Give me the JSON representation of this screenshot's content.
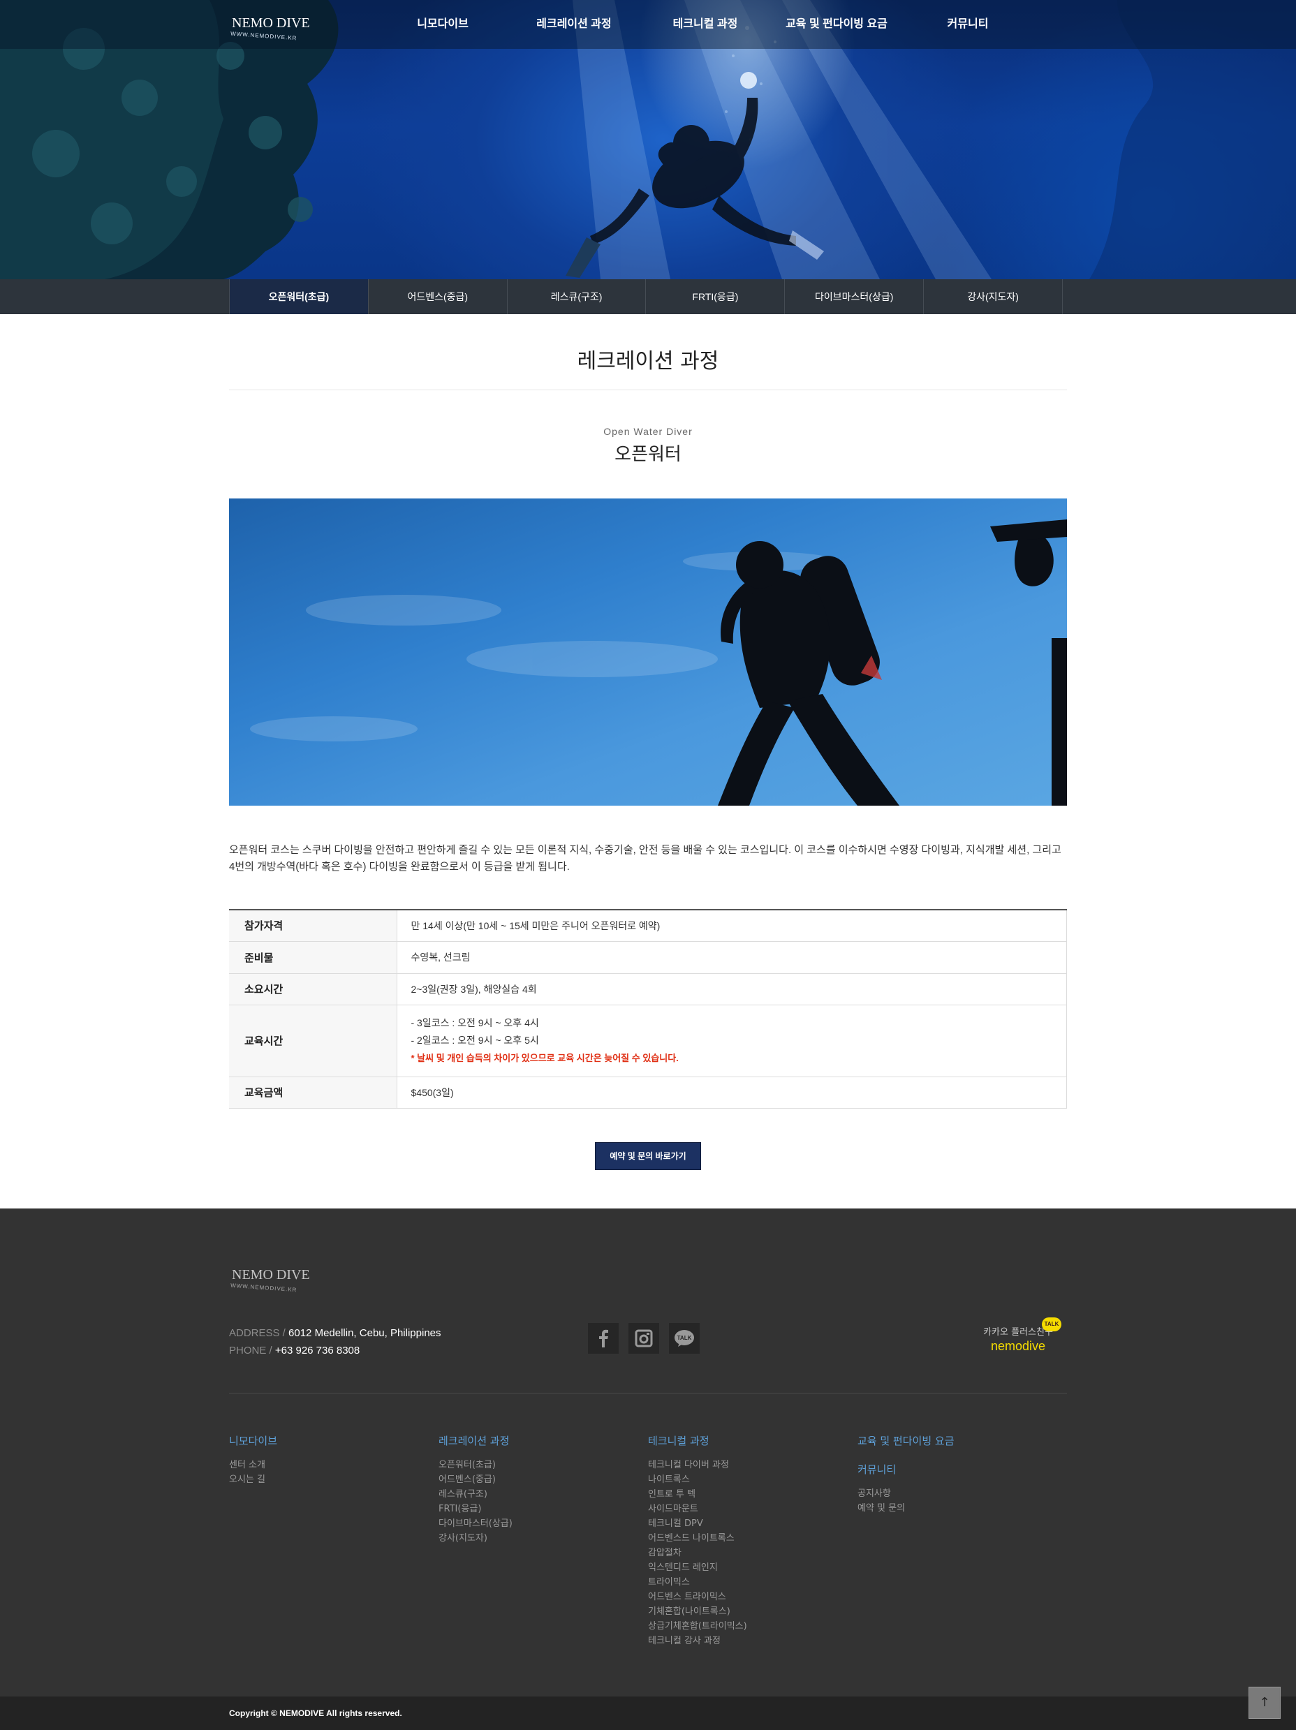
{
  "header": {
    "logo_text": "NEMO DIVE",
    "logo_url_text": "WWW.NEMODIVE.KR",
    "menu": [
      "니모다이브",
      "레크레이션 과정",
      "테크니컬 과정",
      "교육 및 펀다이빙 요금",
      "커뮤니티"
    ]
  },
  "subnav": {
    "items": [
      "오픈워터(초급)",
      "어드벤스(중급)",
      "레스큐(구조)",
      "FRTI(응급)",
      "다이브마스터(상급)",
      "강사(지도자)"
    ],
    "active_index": 0
  },
  "content": {
    "page_title": "레크레이션 과정",
    "course_en": "Open Water Diver",
    "course_ko": "오픈워터",
    "description": "오픈워터 코스는 스쿠버 다이빙을 안전하고 편안하게 즐길 수 있는 모든 이론적 지식, 수중기술, 안전 등을 배울 수 있는 코스입니다. 이 코스를 이수하시면 수영장 다이빙과, 지식개발 세션, 그리고 4번의 개방수역(바다 혹은 호수) 다이빙을 완료함으로서 이 등급을 받게 됩니다.",
    "table": {
      "qualification_label": "참가자격",
      "qualification_value": "만 14세 이상(만 10세 ~ 15세 미만은 주니어 오픈워터로 예약)",
      "supplies_label": "준비물",
      "supplies_value": "수영복, 선크림",
      "duration_label": "소요시간",
      "duration_value": "2~3일(권장 3일), 해양실습 4회",
      "schedule_label": "교육시간",
      "schedule_line1": "- 3일코스 : 오전 9시 ~ 오후 4시",
      "schedule_line2": "- 2일코스 : 오전 9시 ~ 오후 5시",
      "schedule_note": "* 날씨 및 개인 습득의 차이가 있으므로 교육 시간은 늦어질 수 있습니다.",
      "fee_label": "교육금액",
      "fee_value": "$450(3일)"
    },
    "cta_label": "예약 및 문의 바로가기"
  },
  "footer": {
    "address_label": "ADDRESS / ",
    "address_value": "6012 Medellin, Cebu, Philippines",
    "phone_label": "PHONE / ",
    "phone_value": "+63 926 736 8308",
    "kakao_line1": "카카오 플러스친구",
    "kakao_line2": "nemodive",
    "kakao_badge": "TALK",
    "sitemap": {
      "col1_head": "니모다이브",
      "col1_links": [
        "센터 소개",
        "오시는 길"
      ],
      "col2_head": "레크레이션 과정",
      "col2_links": [
        "오픈워터(초급)",
        "어드벤스(중급)",
        "레스큐(구조)",
        "FRTI(응급)",
        "다이브마스터(상급)",
        "강사(지도자)"
      ],
      "col3_head": "테크니컬 과정",
      "col3_links": [
        "테크니컬 다이버 과정",
        "나이트록스",
        "인트로 투 텍",
        "사이드마운트",
        "테크니컬 DPV",
        "어드벤스드 나이트록스",
        "감압절차",
        "익스텐디드 레인지",
        "트라이믹스",
        "어드벤스 트라이믹스",
        "기체혼합(나이트록스)",
        "상급기체혼합(트라이믹스)",
        "테크니컬 강사 과정"
      ],
      "col4_head": "교육 및 펀다이빙 요금",
      "col4b_head": "커뮤니티",
      "col4_links": [
        "공지사항",
        "예약 및 문의"
      ]
    },
    "copyright": "Copyright © NEMODIVE All rights reserved.",
    "to_top": "↑"
  },
  "icons": {
    "facebook": "facebook-icon",
    "instagram": "instagram-icon",
    "kakaotalk": "kakaotalk-icon",
    "badge_text": "TALK"
  },
  "colors": {
    "subnav_active": "#1b2a47",
    "cta_bg": "#1c3162",
    "footer_bg": "#333333",
    "note_red": "#e02f14",
    "sitemap_head": "#5ea0d8",
    "kakao_yellow": "#f5dc00"
  }
}
